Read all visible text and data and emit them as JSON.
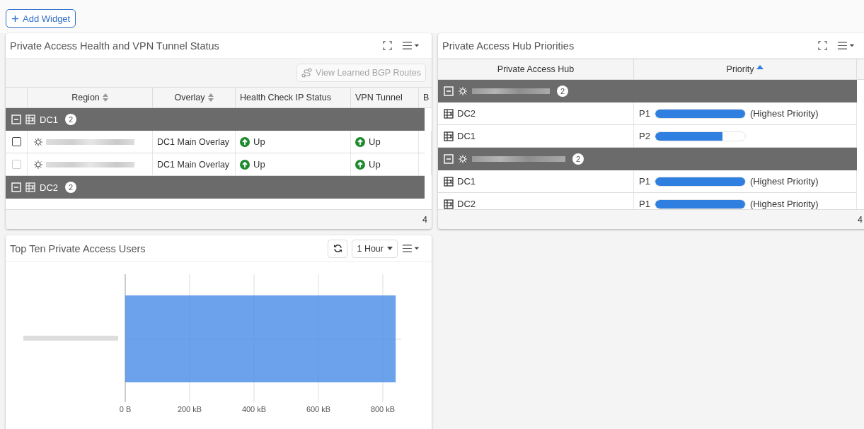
{
  "add_widget_button": {
    "label": "Add Widget"
  },
  "health_panel": {
    "title": "Private Access Health and VPN Tunnel Status",
    "toolbar_button": {
      "label": "View Learned BGP Routes",
      "disabled": true
    },
    "columns": [
      {
        "label": "Region",
        "sortable": true
      },
      {
        "label": "Overlay",
        "sortable": true
      },
      {
        "label": "Health Check IP Status",
        "sortable": false
      },
      {
        "label": "VPN Tunnel",
        "sortable": false
      },
      {
        "label": "B"
      }
    ],
    "groups": [
      {
        "name": "DC1",
        "count": "2",
        "expanded": true,
        "rows": [
          {
            "checked": false,
            "disabled": false,
            "overlay": "DC1 Main Overlay",
            "health": {
              "kind": "up",
              "label": "Up"
            },
            "vpn": {
              "kind": "up",
              "label": "Up"
            }
          },
          {
            "checked": false,
            "disabled": true,
            "overlay": "DC1 Main Overlay",
            "health": {
              "kind": "up",
              "label": "Up"
            },
            "vpn": {
              "kind": "up",
              "label": "Up"
            }
          }
        ]
      },
      {
        "name": "DC2",
        "count": "2",
        "expanded": true
      }
    ],
    "footer_count": "4"
  },
  "hub_panel": {
    "title": "Private Access Hub Priorities",
    "columns": [
      {
        "label": "Private Access Hub",
        "sorted_ascending": false
      },
      {
        "label": "Priority",
        "sorted_ascending": true
      }
    ],
    "groups": [
      {
        "count": "2",
        "expanded": true,
        "rows": [
          {
            "hub": "DC2",
            "priority": "P1",
            "level": 1,
            "note": "(Highest Priority)"
          },
          {
            "hub": "DC1",
            "priority": "P2",
            "level": 0.75
          }
        ]
      },
      {
        "count": "2",
        "expanded": true,
        "rows": [
          {
            "hub": "DC1",
            "priority": "P1",
            "level": 1,
            "note": "(Highest Priority)"
          },
          {
            "hub": "DC2",
            "priority": "P1",
            "level": 1,
            "note": "(Highest Priority)"
          }
        ]
      }
    ],
    "footer_count": "4"
  },
  "users_panel": {
    "title": "Top Ten Private Access Users",
    "time_range": "1 Hour",
    "chart_data": {
      "type": "bar",
      "orientation": "horizontal",
      "grid": true,
      "values": [
        840
      ],
      "xlim": [
        0,
        840
      ],
      "xticks": [
        {
          "value": 0,
          "label": "0 B"
        },
        {
          "value": 200,
          "label": "200 kB"
        },
        {
          "value": 400,
          "label": "400 kB"
        },
        {
          "value": 600,
          "label": "600 kB"
        },
        {
          "value": 800,
          "label": "800 kB"
        }
      ]
    }
  }
}
